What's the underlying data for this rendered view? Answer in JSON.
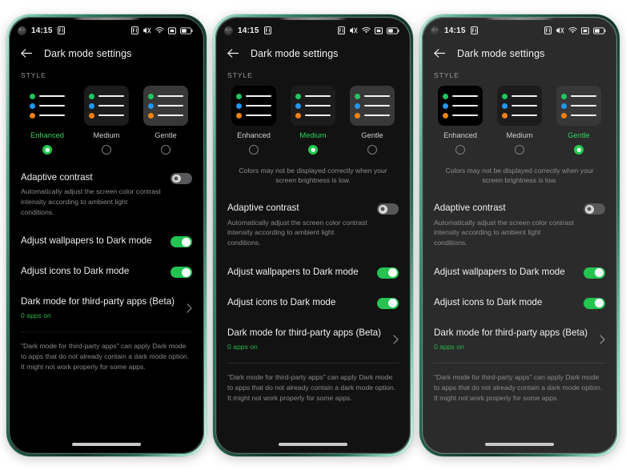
{
  "app": {
    "title": "Dark mode settings",
    "back_icon": "back-arrow-icon"
  },
  "status_bar": {
    "time": "14:15",
    "icons": [
      "dual-sim-icon",
      "nfc-icon",
      "vibrate-mute-icon",
      "wifi-icon",
      "signal-icon",
      "battery-icon"
    ]
  },
  "section": {
    "style_label": "STYLE"
  },
  "styles": {
    "options": [
      {
        "name": "Enhanced",
        "dots": [
          "#22c55e",
          "#2196f3",
          "#f4820b"
        ]
      },
      {
        "name": "Medium",
        "dots": [
          "#22c55e",
          "#2196f3",
          "#f4820b"
        ]
      },
      {
        "name": "Gentle",
        "dots": [
          "#22c55e",
          "#2196f3",
          "#f4820b"
        ]
      }
    ],
    "note": "Colors may not be displayed correctly when your screen brightness is low."
  },
  "settings": {
    "adaptive_contrast": {
      "title": "Adaptive contrast",
      "subtitle": "Automatically adjust the screen color contrast intensity according to ambient light conditions.",
      "state": "off"
    },
    "wallpapers": {
      "title": "Adjust wallpapers to Dark mode",
      "state": "on"
    },
    "icons": {
      "title": "Adjust icons to Dark mode",
      "state": "on"
    },
    "third_party": {
      "title": "Dark mode for third-party apps (Beta)",
      "status": "0 apps on",
      "chevron": "chevron-right-icon"
    },
    "footnote": "\"Dark mode for third-party apps\" can apply Dark mode to apps that do not already contain a dark mode option. It might not work properly for some apps."
  },
  "colors": {
    "accent_green": "#25c84f",
    "label_green": "#2fd35e",
    "toggle_on": "#24c352",
    "toggle_off": "#58585a",
    "bg_enhanced": "#000000",
    "bg_medium": "#121212",
    "bg_gentle": "#2b2b2b",
    "frame_green": "#2f7d64"
  },
  "phones": [
    {
      "id": "phone-enhanced",
      "theme": "t-enhanced",
      "selected_style": 0,
      "show_style_note": false
    },
    {
      "id": "phone-medium",
      "theme": "t-medium",
      "selected_style": 1,
      "show_style_note": true
    },
    {
      "id": "phone-gentle",
      "theme": "t-gentle",
      "selected_style": 2,
      "show_style_note": true
    }
  ]
}
